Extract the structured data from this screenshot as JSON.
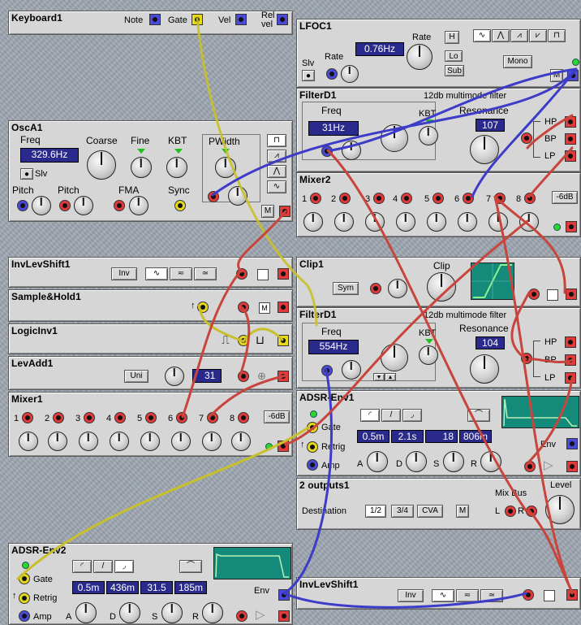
{
  "keyboard": {
    "title": "Keyboard1",
    "note": "Note",
    "gate": "Gate",
    "vel": "Vel",
    "relvel1": "Rel",
    "relvel2": "vel"
  },
  "lfoc": {
    "title": "LFOC1",
    "rate_label": "Rate",
    "rate_value": "0.76Hz",
    "rate2": "Rate",
    "slv": "Slv",
    "h": "H",
    "lo": "Lo",
    "sub": "Sub",
    "mono": "Mono",
    "m": "M"
  },
  "filterd_top": {
    "title": "FilterD1",
    "subtitle": "12db multimode filter",
    "freq": "Freq",
    "freq_value": "31Hz",
    "kbt": "KBT",
    "resonance": "Resonance",
    "res_value": "107",
    "hp": "HP",
    "bp": "BP",
    "lp": "LP"
  },
  "osca": {
    "title": "OscA1",
    "freq": "Freq",
    "freq_value": "329.6Hz",
    "coarse": "Coarse",
    "fine": "Fine",
    "kbt": "KBT",
    "pwidth": "PWidth",
    "slv": "Slv",
    "pitch1": "Pitch",
    "pitch2": "Pitch",
    "fma": "FMA",
    "sync": "Sync",
    "m": "M"
  },
  "mixer2": {
    "title": "Mixer2",
    "ch": [
      "1",
      "2",
      "3",
      "4",
      "5",
      "6",
      "7",
      "8"
    ],
    "db": "-6dB"
  },
  "invlev1": {
    "title": "InvLevShift1",
    "inv": "Inv"
  },
  "clip": {
    "title": "Clip1",
    "clip": "Clip",
    "sym": "Sym"
  },
  "sh": {
    "title": "Sample&Hold1"
  },
  "filterd_bot": {
    "title": "FilterD1",
    "subtitle": "12db multimode filter",
    "freq": "Freq",
    "freq_value": "554Hz",
    "kbt": "KBT",
    "resonance": "Resonance",
    "res_value": "104",
    "hp": "HP",
    "bp": "BP",
    "lp": "LP"
  },
  "logicinv": {
    "title": "LogicInv1"
  },
  "levadd": {
    "title": "LevAdd1",
    "uni": "Uni",
    "value": "31"
  },
  "mixer1": {
    "title": "Mixer1",
    "ch": [
      "1",
      "2",
      "3",
      "4",
      "5",
      "6",
      "7",
      "8"
    ],
    "db": "-6dB"
  },
  "adsr1": {
    "title": "ADSR-Env1",
    "gate": "Gate",
    "retrig": "Retrig",
    "amp": "Amp",
    "a": "A",
    "d": "D",
    "s": "S",
    "r": "R",
    "env": "Env",
    "a_val": "0.5m",
    "d_val": "2.1s",
    "s_val": "18",
    "r_val": "806m"
  },
  "outputs": {
    "title": "2 outputs1",
    "destination": "Destination",
    "d12": "1/2",
    "d34": "3/4",
    "cva": "CVA",
    "m": "M",
    "mixbus": "Mix Bus",
    "level": "Level",
    "l": "L",
    "r": "R"
  },
  "adsr2": {
    "title": "ADSR-Env2",
    "gate": "Gate",
    "retrig": "Retrig",
    "amp": "Amp",
    "a": "A",
    "d": "D",
    "s": "S",
    "r": "R",
    "env": "Env",
    "a_val": "0.5m",
    "d_val": "436m",
    "s_val": "31.5",
    "r_val": "185m"
  },
  "invlev2": {
    "title": "InvLevShift1",
    "inv": "Inv"
  },
  "colors": {
    "cable_red": "#c8453d",
    "cable_blue": "#3c3cc8",
    "cable_yellow": "#c8c02a",
    "display": "#2a2a8c",
    "graph": "#138a7a"
  }
}
